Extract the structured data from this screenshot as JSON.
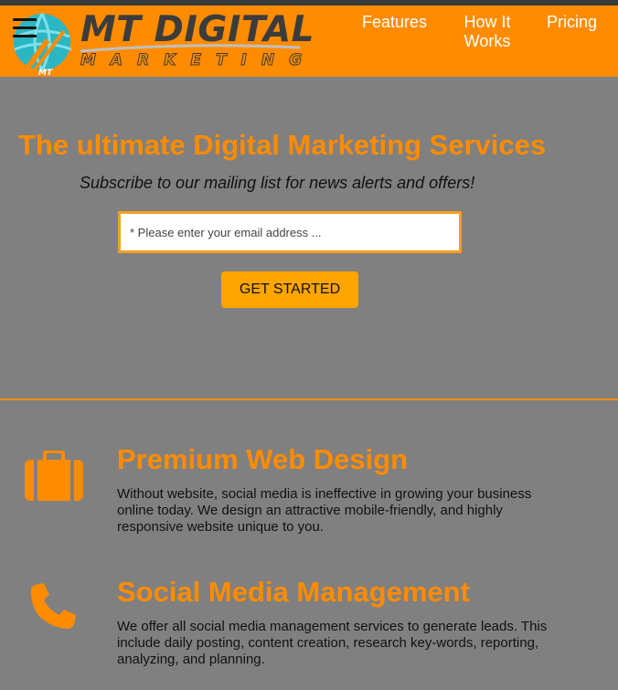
{
  "brand": {
    "name": "MT DIGITAL",
    "tagline": "MARKETING",
    "badge": "MT"
  },
  "nav": {
    "features": "Features",
    "how_it_works": "How It Works",
    "pricing": "Pricing"
  },
  "hero": {
    "title": "The ultimate Digital Marketing Services",
    "subtitle": "Subscribe to our mailing list for news alerts and offers!",
    "email_placeholder": "* Please enter your email address ...",
    "cta_label": "GET STARTED"
  },
  "features": [
    {
      "icon": "briefcase-icon",
      "title": "Premium Web Design",
      "description": "Without website, social media is ineffective in growing your business online today. We design an attractive mobile-friendly, and highly responsive website unique to you."
    },
    {
      "icon": "phone-icon",
      "title": "Social Media Management",
      "description": "We offer all social media management services to generate leads. This include daily posting, content creation, research key-words, reporting, analyzing, and planning."
    }
  ],
  "colors": {
    "accent": "#ff8c00",
    "button": "#ffa500",
    "background": "#808080"
  }
}
